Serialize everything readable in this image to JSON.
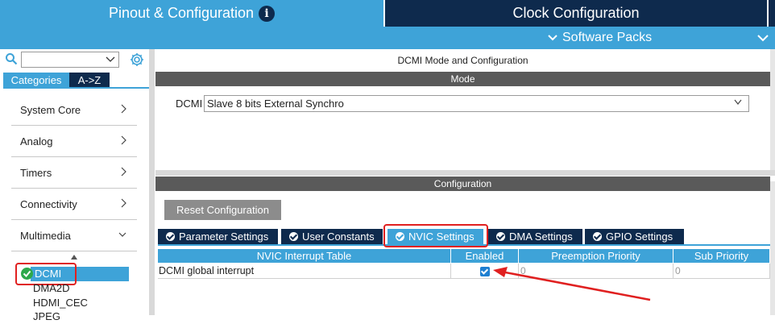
{
  "header": {
    "pinout_tab_label": "Pinout & Configuration",
    "clock_tab_label": "Clock Configuration",
    "software_packs_label": "Software Packs",
    "info_icon_glyph": "i"
  },
  "sidebar": {
    "search_value": "",
    "tab_categories": "Categories",
    "tab_az": "A->Z",
    "categories": [
      {
        "label": "System Core",
        "state": "collapsed"
      },
      {
        "label": "Analog",
        "state": "collapsed"
      },
      {
        "label": "Timers",
        "state": "collapsed"
      },
      {
        "label": "Connectivity",
        "state": "collapsed"
      },
      {
        "label": "Multimedia",
        "state": "expanded"
      }
    ],
    "multimedia_items": [
      "DCMI",
      "DMA2D",
      "HDMI_CEC",
      "JPEG"
    ]
  },
  "mode": {
    "title": "DCMI Mode and Configuration",
    "section_header": "Mode",
    "field_label": "DCMI",
    "field_value": "Slave 8 bits External Synchro"
  },
  "configuration": {
    "section_header": "Configuration",
    "reset_button": "Reset Configuration",
    "tabs": [
      "Parameter Settings",
      "User Constants",
      "NVIC Settings",
      "DMA Settings",
      "GPIO Settings"
    ],
    "active_tab": "NVIC Settings",
    "table": {
      "headers": [
        "NVIC Interrupt Table",
        "Enabled",
        "Preemption Priority",
        "Sub Priority"
      ],
      "rows": [
        {
          "name": "DCMI global interrupt",
          "enabled": true,
          "preemption": "0",
          "sub": "0"
        }
      ]
    }
  },
  "colors": {
    "accent_blue": "#3ea3d8",
    "dark_navy": "#0e2a4d",
    "section_gray": "#5a5a5a",
    "highlight_red": "#e02020",
    "check_green": "#2da84a"
  }
}
